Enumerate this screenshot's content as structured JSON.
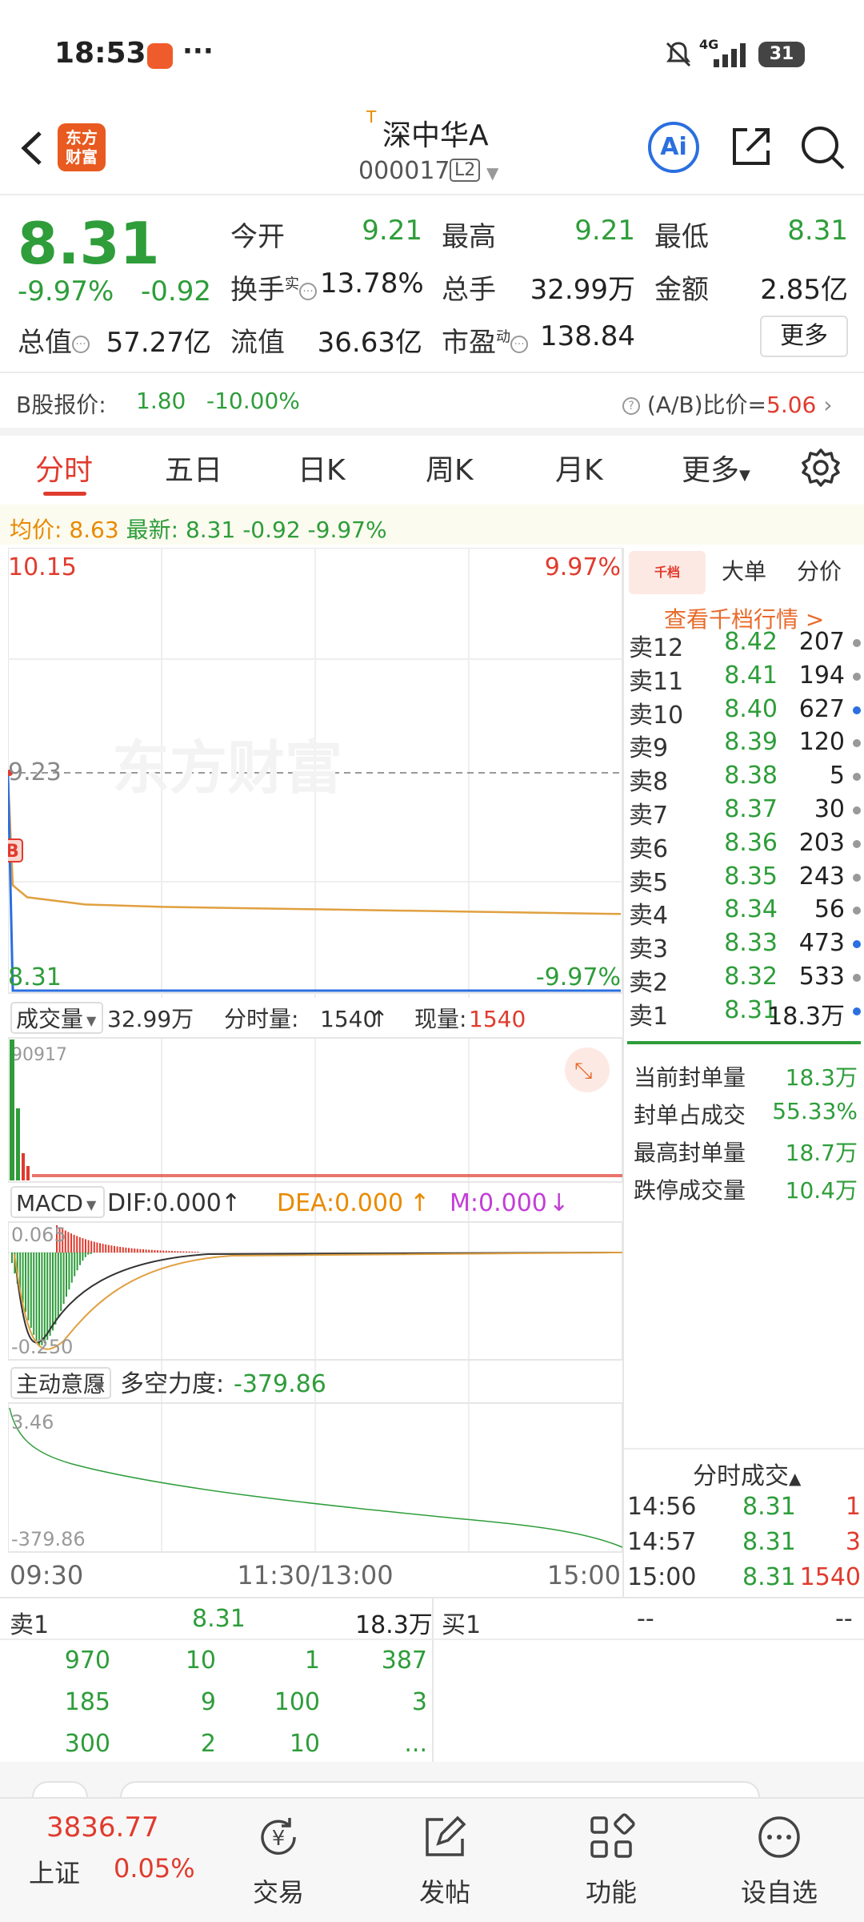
{
  "status_bar": {
    "time": "18:53",
    "dots": "···",
    "network": "4G",
    "battery": "31"
  },
  "header": {
    "logo_text_1": "东方",
    "logo_text_2": "财富",
    "t_mark": "T",
    "stock_name": "深中华A",
    "stock_code": "000017",
    "level_badge": "L2",
    "ai_label": "Ai"
  },
  "quote": {
    "last_price": "8.31",
    "change_pct": "-9.97%",
    "change_amt": "-0.92",
    "open_label": "今开",
    "open": "9.21",
    "high_label": "最高",
    "high": "9.21",
    "low_label": "最低",
    "low": "8.31",
    "turnover_label": "换手",
    "turnover_sup": "实",
    "turnover": "13.78%",
    "volume_label": "总手",
    "volume": "32.99万",
    "amount_label": "金额",
    "amount": "2.85亿",
    "mktcap_label": "总值",
    "mktcap": "57.27亿",
    "float_label": "流值",
    "float_cap": "36.63亿",
    "pe_label": "市盈",
    "pe_sup": "动",
    "pe": "138.84",
    "more": "更多"
  },
  "b_share": {
    "label": "B股报价:",
    "price": "1.80",
    "pct": "-10.00%",
    "ratio_label": "(A/B)比价=",
    "ratio": "5.06"
  },
  "tabs": [
    "分时",
    "五日",
    "日K",
    "周K",
    "月K",
    "更多"
  ],
  "avg_line": {
    "avg_label": "均价:",
    "avg": "8.63",
    "latest_label": "最新:",
    "latest": "8.31",
    "chg": "-0.92",
    "pct": "-9.97%"
  },
  "chart_labels": {
    "price_top": "10.15",
    "pct_top": "9.97%",
    "price_mid": "9.23",
    "price_bottom": "8.31",
    "pct_bottom": "-9.97%",
    "b_marker": "B",
    "watermark": "东方财富",
    "vol_selector": "成交量",
    "vol_total": "32.99万",
    "vol_min_label": "分时量:",
    "vol_min": "1540",
    "vol_now_label": "现量:",
    "vol_now": "1540",
    "vol_max": "90917",
    "macd_selector": "MACD",
    "dif": "DIF:0.000",
    "dea": "DEA:0.000",
    "m": "M:0.000",
    "macd_top": "0.065",
    "macd_bottom": "-0.250",
    "flow_selector": "主动意愿",
    "flow_label": "多空力度:",
    "flow_value": "-379.86",
    "flow_top": "3.46",
    "flow_bottom": "-379.86",
    "time_start": "09:30",
    "time_mid": "11:30/13:00",
    "time_end": "15:00"
  },
  "chart_data": {
    "type": "line",
    "x": [
      "09:30",
      "09:31",
      "09:35",
      "10:00",
      "10:30",
      "11:30/13:00",
      "14:00",
      "15:00"
    ],
    "series": [
      {
        "values": [
          9.21,
          8.31,
          8.31,
          8.31,
          8.31,
          8.31,
          8.31,
          8.31
        ]
      },
      {
        "values": [
          9.21,
          8.75,
          8.7,
          8.67,
          8.66,
          8.65,
          8.64,
          8.63
        ]
      }
    ],
    "ylim": [
      8.31,
      10.15
    ]
  },
  "side_panel": {
    "tabs": [
      "千档",
      "大单",
      "分价"
    ],
    "view_link": "查看千档行情 >",
    "asks": [
      {
        "label": "卖12",
        "price": "8.42",
        "vol": "207",
        "dot": "gray"
      },
      {
        "label": "卖11",
        "price": "8.41",
        "vol": "194",
        "dot": "gray"
      },
      {
        "label": "卖10",
        "price": "8.40",
        "vol": "627",
        "dot": "blue"
      },
      {
        "label": "卖9",
        "price": "8.39",
        "vol": "120",
        "dot": "gray"
      },
      {
        "label": "卖8",
        "price": "8.38",
        "vol": "5",
        "dot": "gray"
      },
      {
        "label": "卖7",
        "price": "8.37",
        "vol": "30",
        "dot": "gray"
      },
      {
        "label": "卖6",
        "price": "8.36",
        "vol": "203",
        "dot": "gray"
      },
      {
        "label": "卖5",
        "price": "8.35",
        "vol": "243",
        "dot": "gray"
      },
      {
        "label": "卖4",
        "price": "8.34",
        "vol": "56",
        "dot": "gray"
      },
      {
        "label": "卖3",
        "price": "8.33",
        "vol": "473",
        "dot": "blue"
      },
      {
        "label": "卖2",
        "price": "8.32",
        "vol": "533",
        "dot": "gray"
      },
      {
        "label": "卖1",
        "price": "8.31",
        "vol": "18.3万",
        "dot": "blue"
      }
    ],
    "seal": [
      {
        "k": "当前封单量",
        "v": "18.3万"
      },
      {
        "k": "封单占成交",
        "v": "55.33%"
      },
      {
        "k": "最高封单量",
        "v": "18.7万"
      },
      {
        "k": "跌停成交量",
        "v": "10.4万"
      }
    ],
    "ticks_title": "分时成交",
    "ticks": [
      {
        "t": "14:56",
        "p": "8.31",
        "v": "1"
      },
      {
        "t": "14:57",
        "p": "8.31",
        "v": "3"
      },
      {
        "t": "15:00",
        "p": "8.31",
        "v": "1540"
      }
    ]
  },
  "book": {
    "sell_label": "卖1",
    "sell_price": "8.31",
    "sell_vol": "18.3万",
    "buy_label": "买1",
    "buy_price": "--",
    "buy_vol": "--",
    "rows": [
      [
        "970",
        "10",
        "1",
        "387"
      ],
      [
        "185",
        "9",
        "100",
        "3"
      ],
      [
        "300",
        "2",
        "10",
        "..."
      ]
    ]
  },
  "bottom_nav": {
    "index_value": "3836.77",
    "index_name": "上证",
    "index_pct": "0.05%",
    "trade": "交易",
    "post": "发帖",
    "func": "功能",
    "watch": "设自选",
    "trade_glyph": "¥"
  }
}
